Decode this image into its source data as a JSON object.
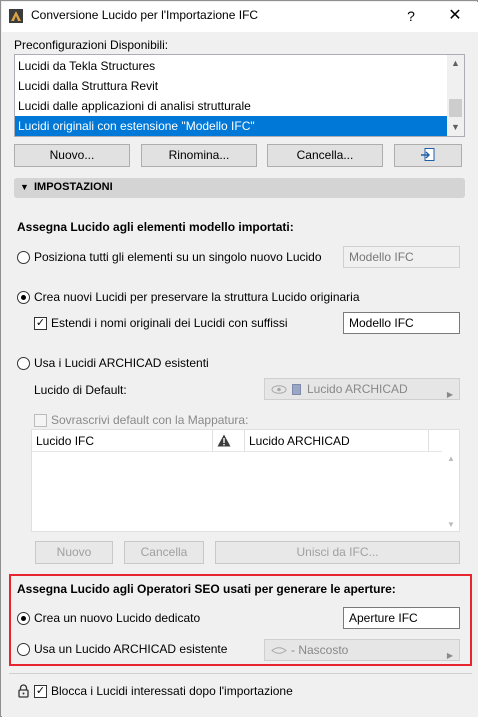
{
  "window": {
    "title": "Conversione Lucido per l'Importazione IFC",
    "help": "?",
    "close": "✕"
  },
  "presets": {
    "heading": "Preconfigurazioni Disponibili:",
    "items": [
      "Lucidi da Tekla Structures",
      "Lucidi dalla Struttura Revit",
      "Lucidi dalle applicazioni di analisi strutturale",
      "Lucidi originali con estensione \"Modello IFC\""
    ],
    "selected_index": 3,
    "buttons": {
      "new": "Nuovo...",
      "rename": "Rinomina...",
      "delete": "Cancella..."
    }
  },
  "settings": {
    "header": "IMPOSTAZIONI",
    "assign_heading": "Assegna Lucido agli elementi modello importati:",
    "opt_single": "Posiziona tutti gli elementi su un singolo nuovo Lucido",
    "opt_single_value": "Modello IFC",
    "opt_new": "Crea nuovi Lucidi per preservare la struttura Lucido originaria",
    "extend_names": "Estendi i nomi originali dei Lucidi con suffissi",
    "extend_value": "Modello IFC",
    "opt_existing": "Usa i Lucidi ARCHICAD esistenti",
    "default_label": "Lucido di Default:",
    "default_value": "Lucido ARCHICAD",
    "overwrite": "Sovrascrivi default con la Mappatura:",
    "table_columns": [
      "Lucido IFC",
      "Lucido ARCHICAD"
    ],
    "table_buttons": {
      "new": "Nuovo",
      "delete": "Cancella",
      "merge": "Unisci da IFC..."
    }
  },
  "openings": {
    "heading": "Assegna Lucido agli Operatori SEO usati per generare le aperture:",
    "opt_new": "Crea un nuovo Lucido dedicato",
    "opt_new_value": "Aperture IFC",
    "opt_existing": "Usa un Lucido ARCHICAD esistente",
    "existing_value": "- Nascosto"
  },
  "lock": {
    "label": "Blocca i Lucidi interessati dopo l'importazione"
  },
  "state": {
    "assign_choice": "opt_new",
    "extend_names_checked": true,
    "overwrite_checked": false,
    "openings_choice": "opt_new",
    "lock_checked": true
  },
  "colors": {
    "selection": "#0078d7",
    "highlight_border": "#e8242e"
  }
}
